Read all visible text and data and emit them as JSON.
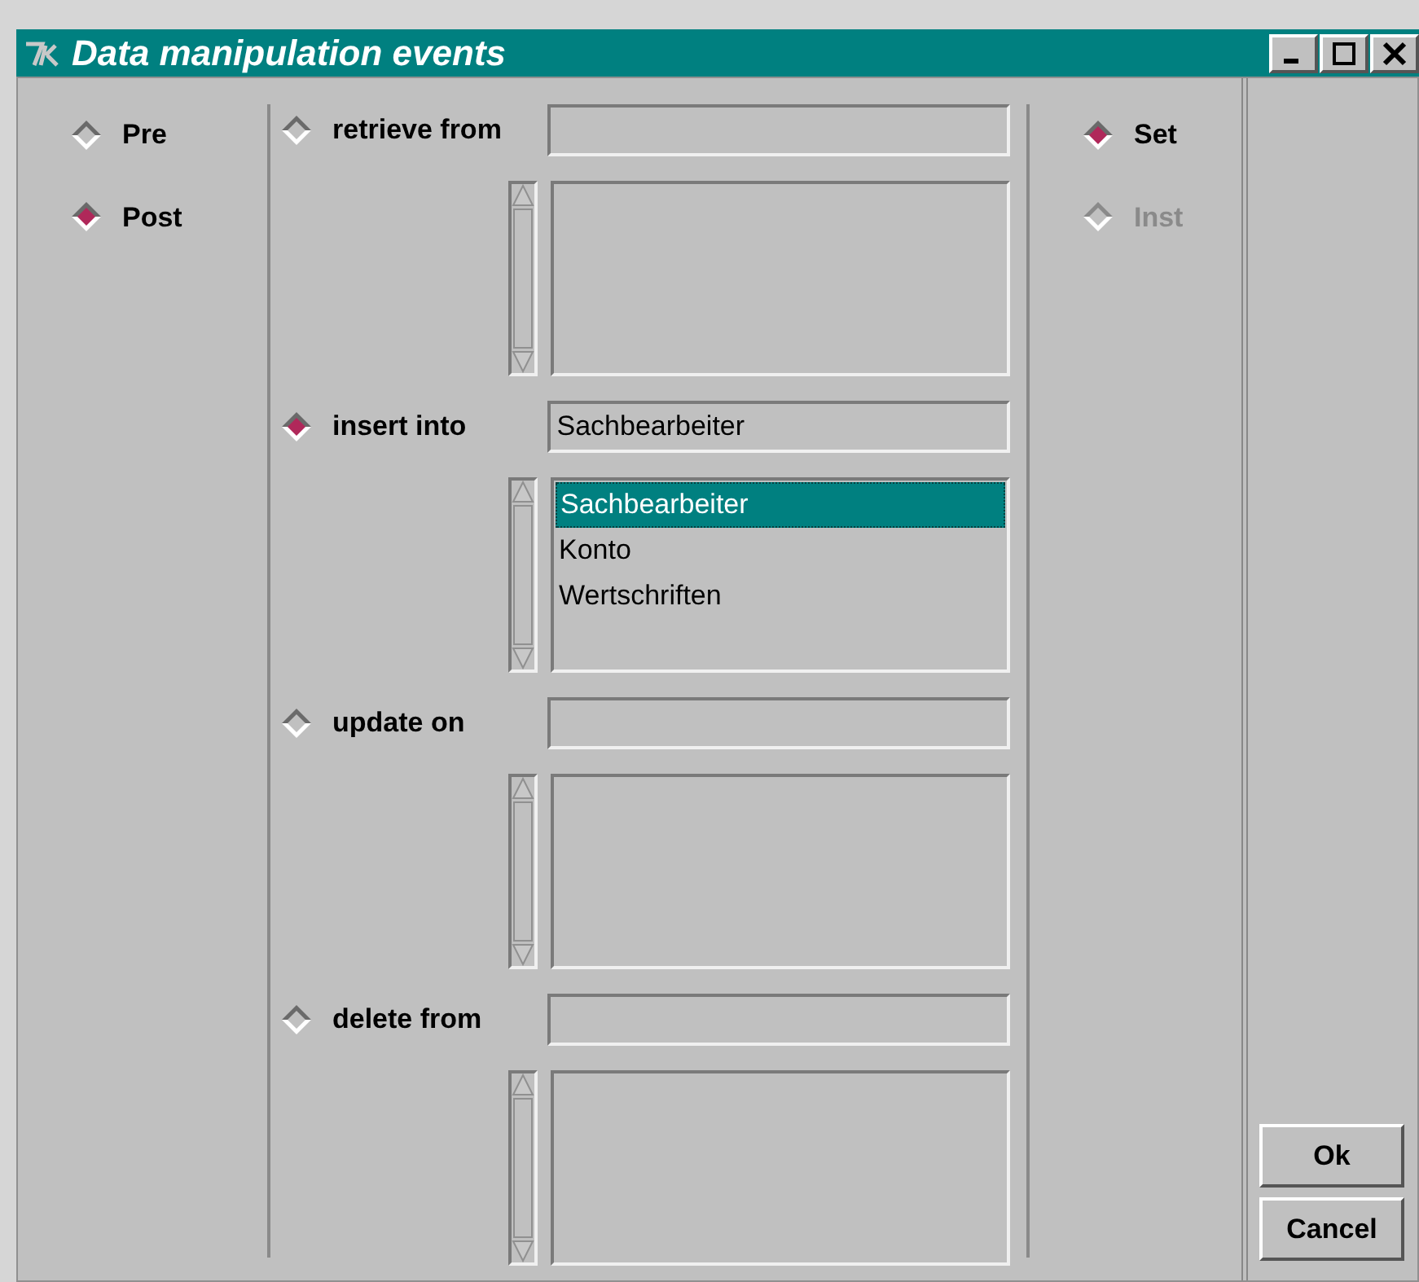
{
  "window": {
    "title": "Data manipulation events"
  },
  "timing": [
    {
      "label": "Pre",
      "selected": false
    },
    {
      "label": "Post",
      "selected": true
    }
  ],
  "events": [
    {
      "label": "retrieve from",
      "selected": false
    },
    {
      "label": "insert into",
      "selected": true,
      "value": "Sachbearbeiter",
      "items": [
        {
          "label": "Sachbearbeiter",
          "selected": true
        },
        {
          "label": "Konto",
          "selected": false
        },
        {
          "label": "Wertschriften",
          "selected": false
        }
      ]
    },
    {
      "label": "update on",
      "selected": false
    },
    {
      "label": "delete from",
      "selected": false
    }
  ],
  "scope": [
    {
      "label": "Set",
      "selected": true,
      "disabled": false
    },
    {
      "label": "Inst",
      "selected": false,
      "disabled": true
    }
  ],
  "buttons": [
    "Ok",
    "Cancel"
  ]
}
